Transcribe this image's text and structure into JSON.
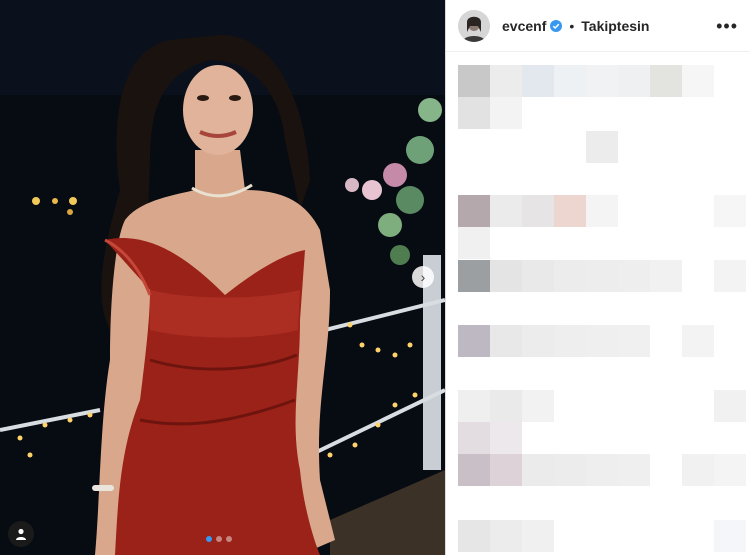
{
  "post": {
    "username": "evcenf",
    "verified": true,
    "separator": "•",
    "follow_status": "Takiptesin",
    "more_icon": "more-horizontal-icon",
    "carousel": {
      "slide_count": 3,
      "active_index": 0,
      "next_icon": "chevron-right-icon",
      "tag_icon": "user-tag-icon"
    }
  },
  "colors": {
    "dress": "#9b2218",
    "verified_blue": "#3897f0",
    "background_night": "#0b1320"
  }
}
